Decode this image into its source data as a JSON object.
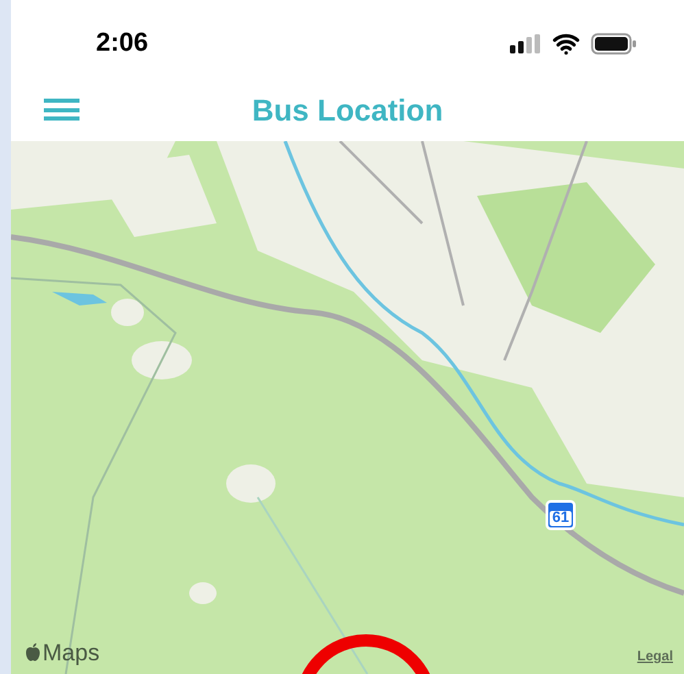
{
  "status_bar": {
    "time": "2:06"
  },
  "nav_bar": {
    "title": "Bus Location"
  },
  "map": {
    "route_shield": "61",
    "attribution": "Maps",
    "legal_link": "Legal"
  }
}
